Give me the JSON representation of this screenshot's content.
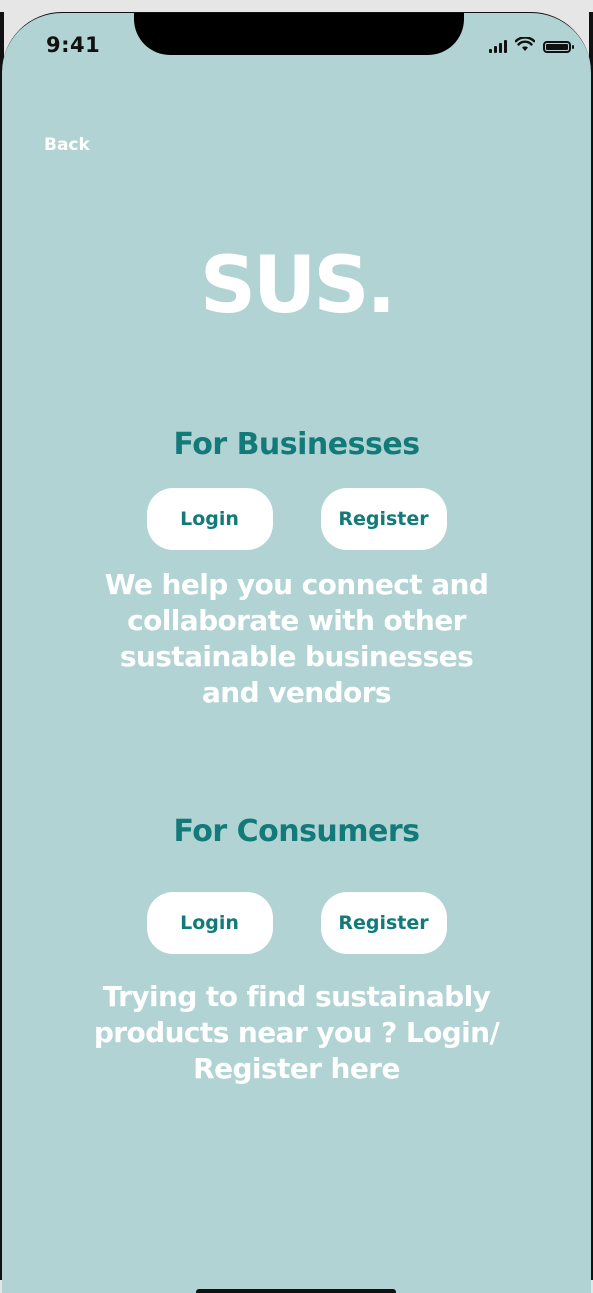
{
  "status_bar": {
    "time": "9:41",
    "icons": [
      "signal-icon",
      "wifi-icon",
      "battery-icon"
    ]
  },
  "nav": {
    "back_label": "Back"
  },
  "logo": {
    "text": "SUS."
  },
  "businesses": {
    "title": "For Businesses",
    "login_label": "Login",
    "register_label": "Register",
    "description": "We help you connect and collaborate with other sustainable businesses and vendors"
  },
  "consumers": {
    "title": "For Consumers",
    "login_label": "Login",
    "register_label": "Register",
    "description": "Trying to find sustainably products near you ? Login/ Register here"
  },
  "colors": {
    "background": "#b2d3d3",
    "accent": "#137a7a",
    "text_light": "#ffffff"
  }
}
